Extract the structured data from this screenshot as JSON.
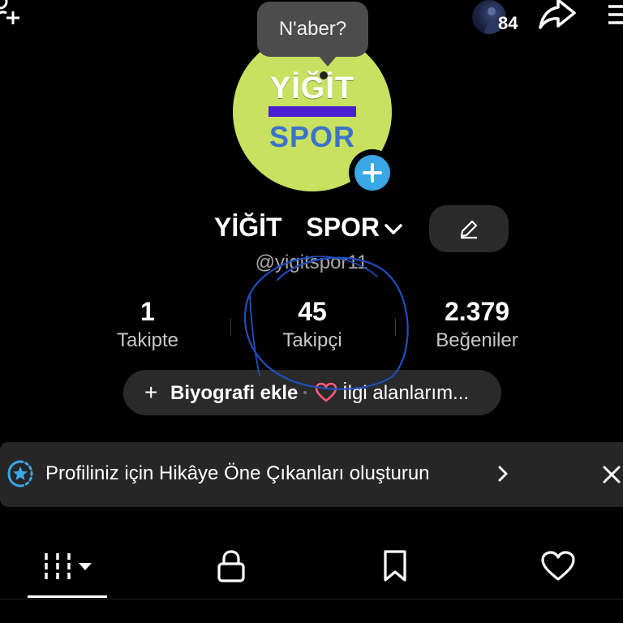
{
  "topbar": {
    "add_friend_icon": "person-add-icon",
    "story_count": "84",
    "share_icon": "share-icon",
    "menu_icon": "menu-icon"
  },
  "avatar": {
    "logo_line1": "YİĞİT",
    "logo_line2": "SPOR",
    "background_color": "#c9e160",
    "bar_color": "#4a1fd0",
    "add_icon": "plus-icon"
  },
  "tooltip": {
    "text": "N'aber?"
  },
  "profile": {
    "name": "YİĞİT  SPOR",
    "username": "@yigitspor11",
    "edit_icon": "pencil-icon"
  },
  "stats": [
    {
      "value": "1",
      "label": "Takipte"
    },
    {
      "value": "45",
      "label": "Takipçi"
    },
    {
      "value": "2.379",
      "label": "Beğeniler"
    }
  ],
  "bio": {
    "add_bio_label": "Biyografi ekle",
    "interests_label": "İlgi alanlarım..."
  },
  "banner": {
    "text": "Profiliniz için Hikâye Öne Çıkanları oluşturun",
    "icon": "star-badge-icon"
  },
  "tabs": [
    {
      "name": "videos",
      "icon": "grid-icon",
      "active": true
    },
    {
      "name": "private",
      "icon": "lock-icon",
      "active": false
    },
    {
      "name": "saved",
      "icon": "bookmark-icon",
      "active": false
    },
    {
      "name": "liked",
      "icon": "heart-icon",
      "active": false
    }
  ],
  "colors": {
    "background": "#000000",
    "accent_blue": "#3aa7e6",
    "heart_pink": "#ff5a79",
    "annotation_blue": "#1f4fbf"
  }
}
